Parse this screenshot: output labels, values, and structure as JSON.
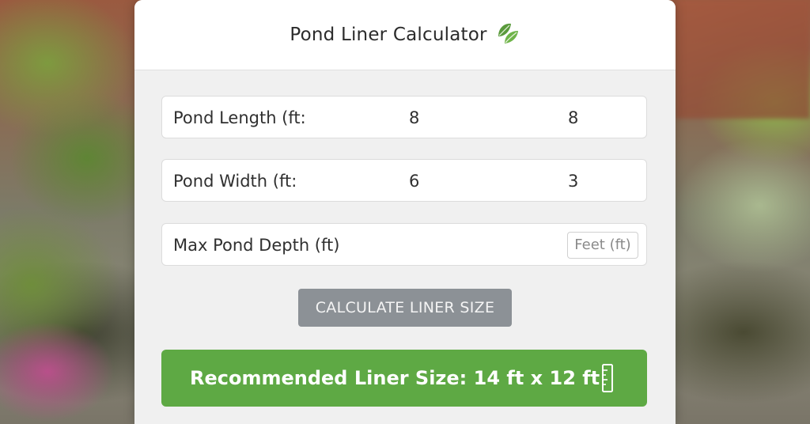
{
  "calculator": {
    "title": "Pond Liner Calculator",
    "title_icon": "leaf-icon",
    "fields": [
      {
        "label": "Pond Length (ft:",
        "value_1": "8",
        "value_2": "8"
      },
      {
        "label": "Pond Width (ft:",
        "value_1": "6",
        "value_2": "3"
      },
      {
        "label": "Max Pond Depth (ft)",
        "unit_placeholder": "Feet (ft)"
      }
    ],
    "calculate_label": "CALCULATE LINER SIZE",
    "result_text": "Recommended Liner Size: 14 ft x 12 ft",
    "result_icon": "ruler-icon"
  },
  "colors": {
    "accent_green": "#5ea944",
    "button_gray": "#8c9196",
    "card_bg": "#f0f0f0"
  }
}
